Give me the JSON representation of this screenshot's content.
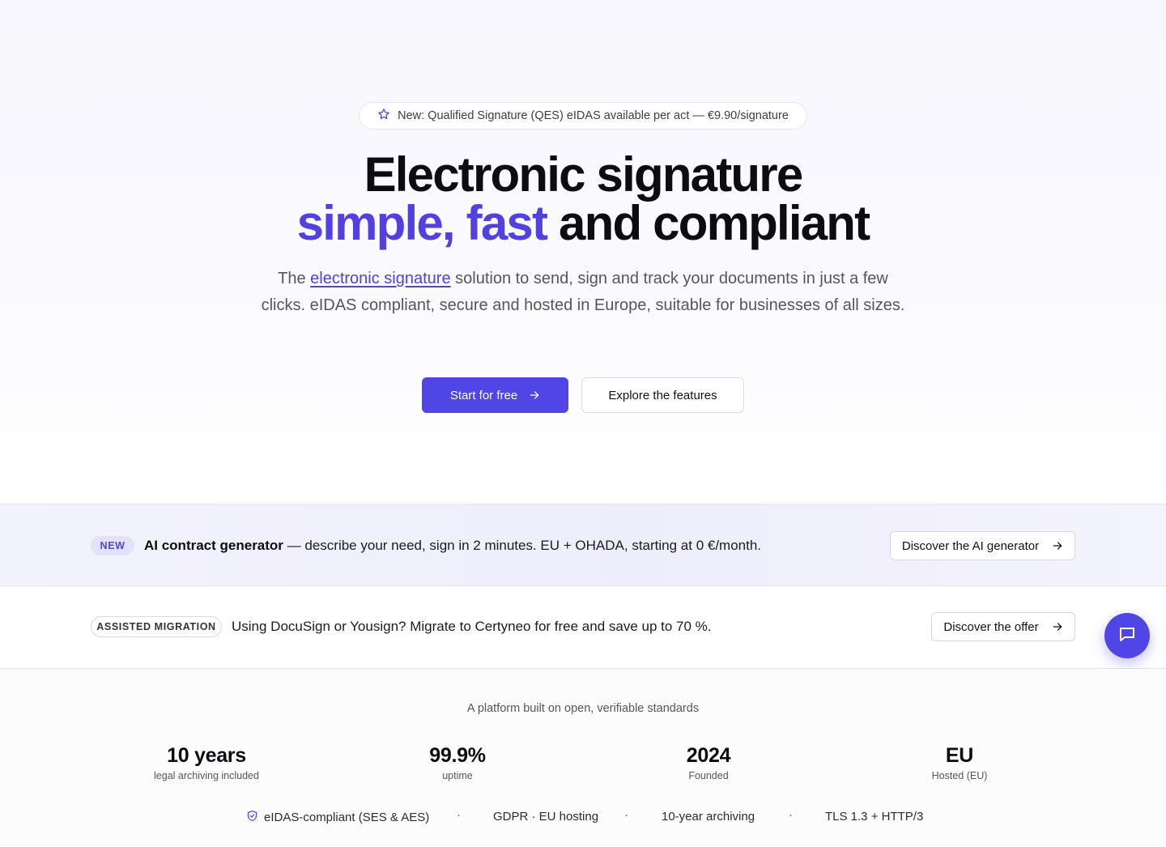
{
  "announcement": {
    "icon": "star-icon",
    "text": "New: Qualified Signature (QES) eIDAS available per act — €9.90/signature"
  },
  "hero": {
    "headline_line1": "Electronic signature",
    "headline_accent": "simple, fast",
    "headline_rest": " and compliant",
    "subtitle_before": "The ",
    "subtitle_link": "electronic signature",
    "subtitle_after": " solution to send, sign and track your documents in just a few clicks. eIDAS compliant, secure and hosted in Europe, suitable for businesses of all sizes.",
    "primary_cta": "Start for free",
    "secondary_cta": "Explore the features"
  },
  "ai_banner": {
    "badge": "NEW",
    "title": "AI contract generator",
    "text": " — describe your need, sign in 2 minutes. EU + OHADA, starting at 0 €/month.",
    "cta": "Discover the AI generator"
  },
  "migration_banner": {
    "badge": "ASSISTED MIGRATION",
    "text": "Using DocuSign or Yousign? Migrate to Certyneo for free and save up to 70 %.",
    "cta": "Discover the offer"
  },
  "stats": {
    "caption": "A platform built on open, verifiable standards",
    "items": [
      {
        "value": "10 years",
        "label": "legal archiving included"
      },
      {
        "value": "99.9%",
        "label": "uptime"
      },
      {
        "value": "2024",
        "label": "Founded"
      },
      {
        "value": "EU",
        "label": "Hosted (EU)"
      }
    ],
    "trust": [
      "eIDAS-compliant (SES & AES)",
      "GDPR · EU hosting",
      "10-year archiving",
      "TLS 1.3 + HTTP/3"
    ],
    "separator": "·"
  },
  "chat": {
    "icon": "chat-bubble-icon"
  },
  "colors": {
    "accent": "#4f46e5",
    "accent_text": "#5141e0",
    "heading": "#0c0c12",
    "muted": "#55555f"
  }
}
